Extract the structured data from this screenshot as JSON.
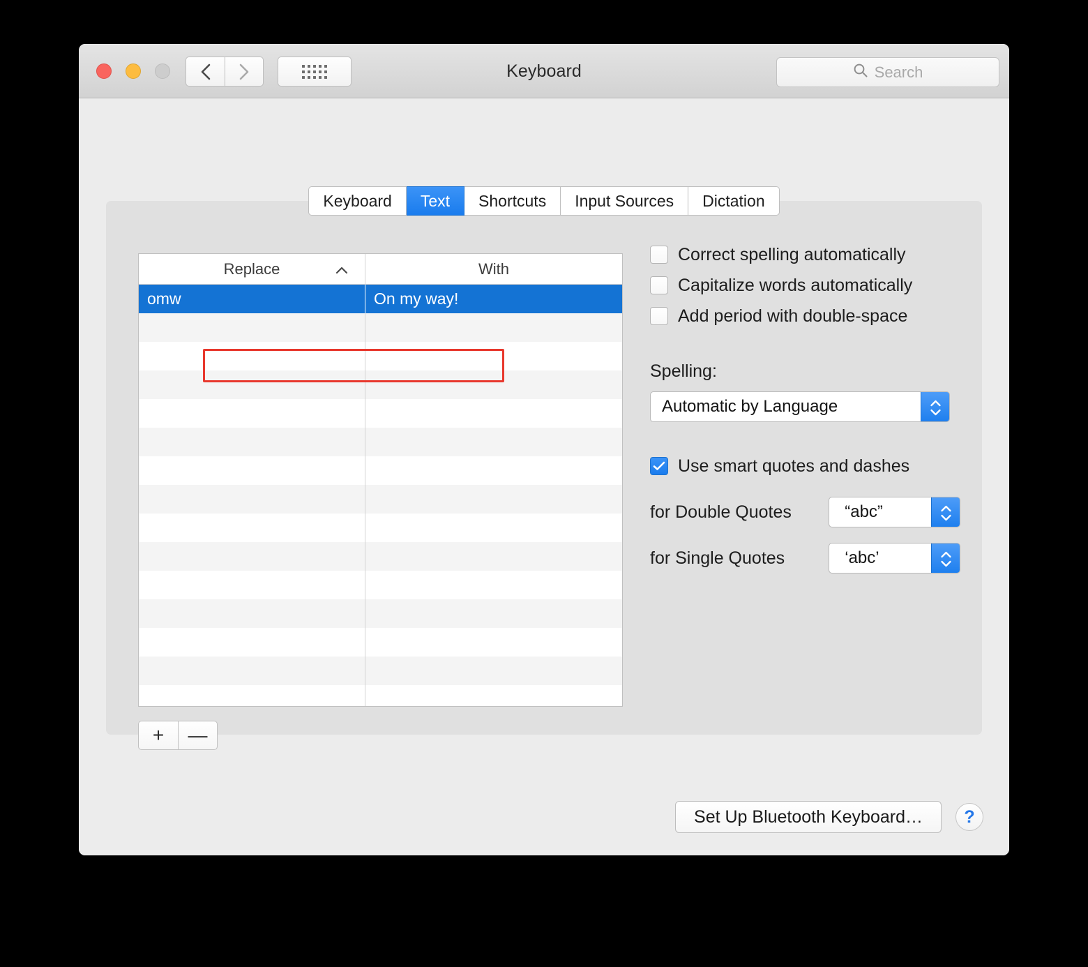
{
  "window": {
    "title": "Keyboard",
    "traffic_lights": [
      "close",
      "minimize",
      "zoom"
    ],
    "nav_back_icon": "chevron-left-icon",
    "nav_forward_icon": "chevron-right-icon",
    "show_all_icon": "grid-dots-icon",
    "search": {
      "placeholder": "Search",
      "value": "",
      "icon": "search-icon"
    }
  },
  "tabs": [
    {
      "label": "Keyboard",
      "active": false
    },
    {
      "label": "Text",
      "active": true
    },
    {
      "label": "Shortcuts",
      "active": false
    },
    {
      "label": "Input Sources",
      "active": false
    },
    {
      "label": "Dictation",
      "active": false
    }
  ],
  "table": {
    "columns": [
      {
        "label": "Replace",
        "sort": "ascending",
        "sort_icon": "chevron-up-icon"
      },
      {
        "label": "With",
        "sort": "none"
      }
    ],
    "rows": [
      {
        "replace": "omw",
        "with": "On my way!",
        "selected": true
      },
      {
        "replace": "",
        "with": "",
        "selected": false
      },
      {
        "replace": "",
        "with": "",
        "selected": false
      },
      {
        "replace": "",
        "with": "",
        "selected": false
      },
      {
        "replace": "",
        "with": "",
        "selected": false
      },
      {
        "replace": "",
        "with": "",
        "selected": false
      },
      {
        "replace": "",
        "with": "",
        "selected": false
      },
      {
        "replace": "",
        "with": "",
        "selected": false
      },
      {
        "replace": "",
        "with": "",
        "selected": false
      },
      {
        "replace": "",
        "with": "",
        "selected": false
      },
      {
        "replace": "",
        "with": "",
        "selected": false
      },
      {
        "replace": "",
        "with": "",
        "selected": false
      },
      {
        "replace": "",
        "with": "",
        "selected": false
      },
      {
        "replace": "",
        "with": "",
        "selected": false
      },
      {
        "replace": "",
        "with": "",
        "selected": false
      },
      {
        "replace": "",
        "with": "",
        "selected": false
      }
    ],
    "add_label": "+",
    "remove_label": "—"
  },
  "options": {
    "checkboxes": [
      {
        "label": "Correct spelling automatically",
        "checked": false,
        "highlighted": true
      },
      {
        "label": "Capitalize words automatically",
        "checked": false,
        "highlighted": false
      },
      {
        "label": "Add period with double-space",
        "checked": false,
        "highlighted": false
      }
    ],
    "spelling": {
      "label": "Spelling:",
      "value": "Automatic by Language"
    },
    "smart_quotes": {
      "label": "Use smart quotes and dashes",
      "checked": true,
      "double_quotes_label": "for Double Quotes",
      "double_quotes_value": "“abc”",
      "single_quotes_label": "for Single Quotes",
      "single_quotes_value": "‘abc’"
    }
  },
  "footer": {
    "bluetooth_button": "Set Up Bluetooth Keyboard…",
    "help_label": "?"
  },
  "colors": {
    "accent_blue": "#1a7ced",
    "selection_blue": "#1473d4",
    "highlight_red": "#e8382d",
    "window_bg": "#ececec",
    "panel_bg": "#e0e0e0"
  }
}
